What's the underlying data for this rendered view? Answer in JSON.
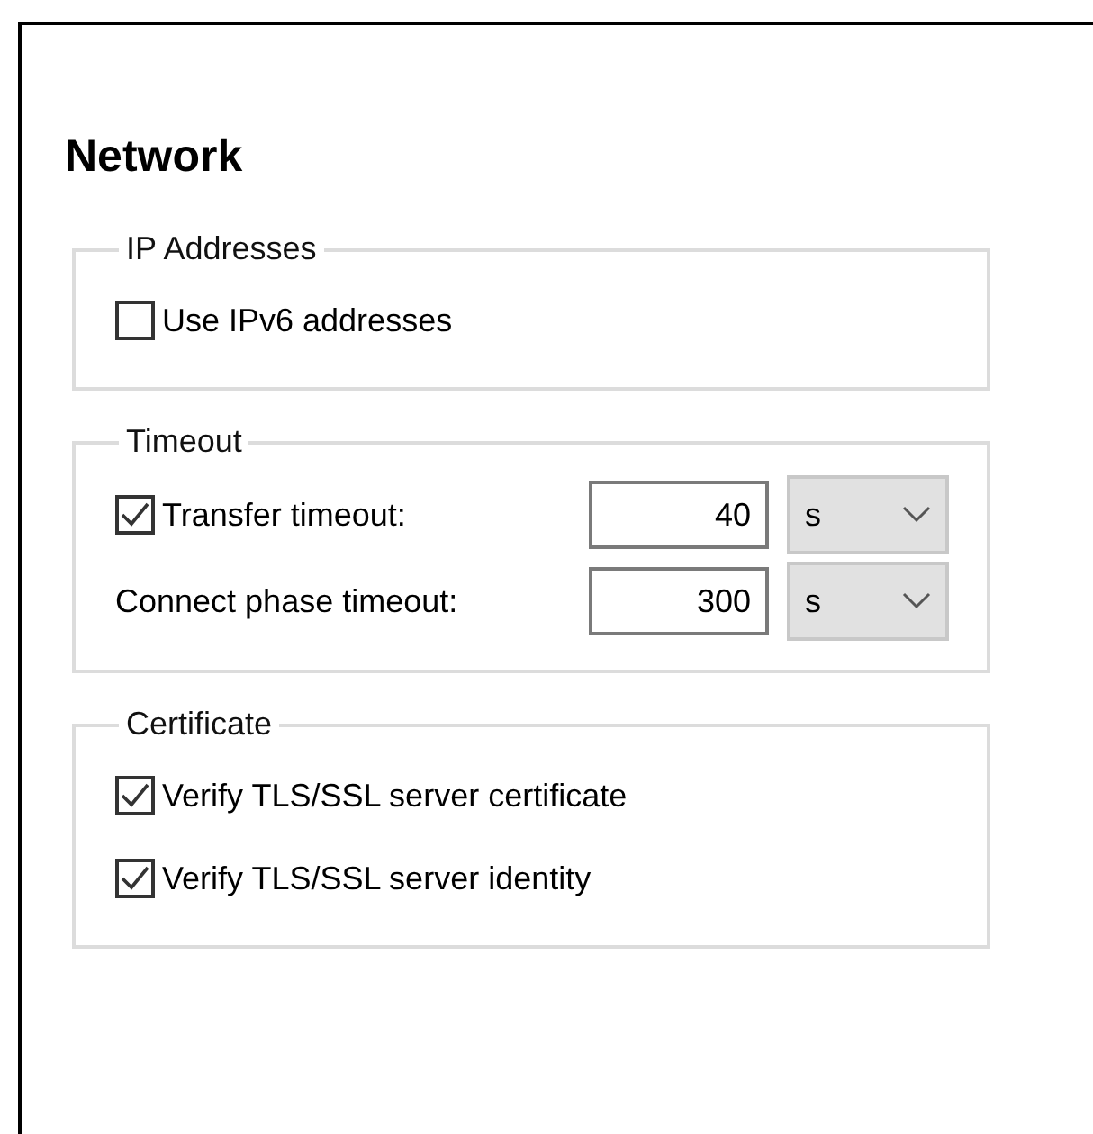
{
  "title": "Network",
  "groups": [
    {
      "title": "IP Addresses",
      "rows": [
        {
          "kind": "checkbox",
          "label": "Use IPv6 addresses",
          "checked": false
        }
      ]
    },
    {
      "title": "Timeout",
      "rows": [
        {
          "kind": "checkbox-number",
          "label": "Transfer timeout:",
          "checked": true,
          "value": "40",
          "unit": "s"
        },
        {
          "kind": "number",
          "label": "Connect phase timeout:",
          "value": "300",
          "unit": "s"
        }
      ]
    },
    {
      "title": "Certificate",
      "rows": [
        {
          "kind": "checkbox",
          "label": "Verify TLS/SSL server certificate",
          "checked": true
        },
        {
          "kind": "checkbox",
          "label": "Verify TLS/SSL server identity",
          "checked": true
        }
      ]
    }
  ]
}
